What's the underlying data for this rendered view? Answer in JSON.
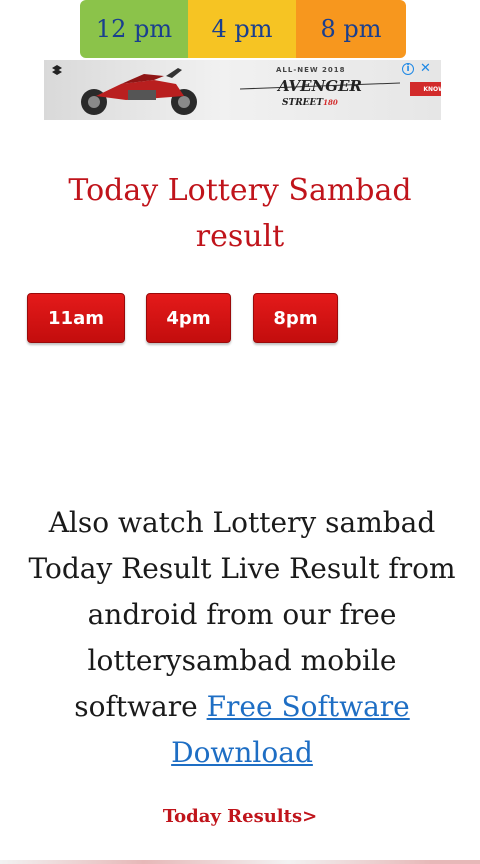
{
  "time_tabs": [
    "12 pm",
    "4 pm",
    "8 pm"
  ],
  "ad": {
    "headline": "ALL-NEW 2018",
    "logo_text": "AVENGER",
    "street_text": "STREET",
    "model_number": "180",
    "cta": "KNOW MORE",
    "brand_color": "#d22b2b"
  },
  "title": "Today Lottery Sambad result",
  "result_buttons": [
    "11am",
    "4pm",
    "8pm"
  ],
  "info": {
    "text": "Also watch Lottery sambad Today Result Live Result from android from our free lotterysambad mobile software ",
    "link_text": "Free Software Download"
  },
  "today_results_link": "Today Results>",
  "colors": {
    "accent_red": "#c0141b",
    "link_blue": "#1e6ec4",
    "tab_green": "#8bc34a",
    "tab_yellow": "#f6c423",
    "tab_orange": "#f7971e"
  },
  "icons": [
    "ad-info-icon",
    "ad-close-icon",
    "brand-logo-icon"
  ]
}
